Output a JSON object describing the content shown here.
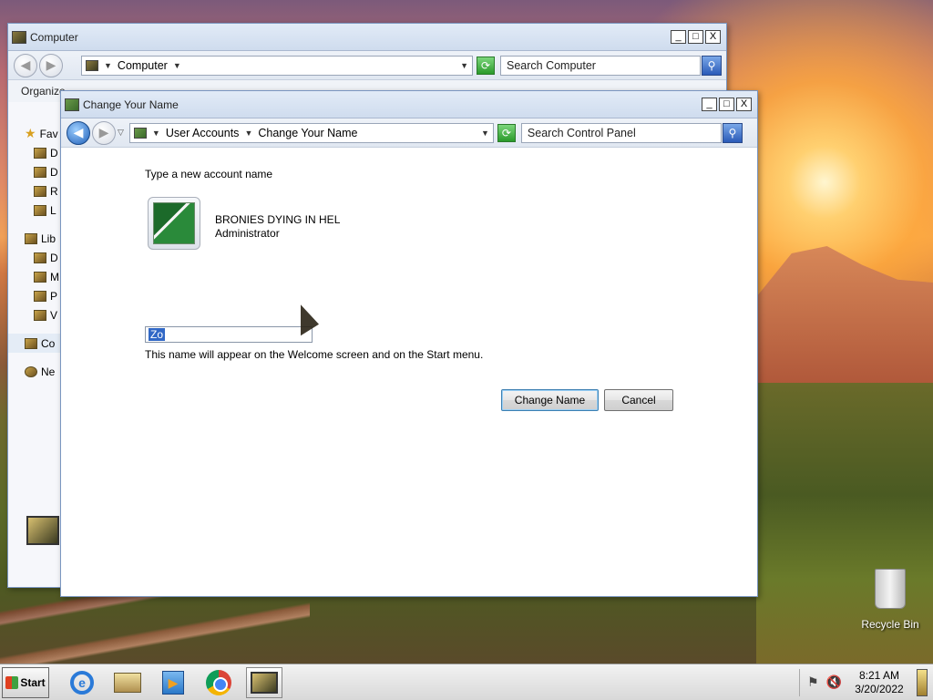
{
  "desktop": {
    "recycle_bin_label": "Recycle Bin"
  },
  "back_window": {
    "title": "Computer",
    "address": "Computer",
    "search_placeholder": "Search Computer",
    "toolbar_organize": "Organize",
    "nav_items": [
      "Favorites",
      "D",
      "D",
      "R",
      "L",
      "Libraries",
      "D",
      "M",
      "P",
      "V",
      "Computer",
      "Network"
    ],
    "nav_labels_visible": [
      "Fav",
      "D",
      "D",
      "R",
      "L",
      "Lib",
      "D",
      "M",
      "P",
      "V",
      "Co",
      "Ne"
    ]
  },
  "front_window": {
    "title": "Change Your Name",
    "breadcrumb": [
      "User Accounts",
      "Change Your Name"
    ],
    "search_placeholder": "Search Control Panel",
    "heading": "Type a new account name",
    "user_name": "BRONIES DYING IN HEL",
    "user_role": "Administrator",
    "name_input_value": "Zo",
    "hint": "This name will appear on the Welcome screen and on the Start menu.",
    "change_name_button": "Change Name",
    "cancel_button": "Cancel"
  },
  "window_controls": {
    "minimize": "_",
    "maximize": "□",
    "close": "X"
  },
  "taskbar": {
    "start_label": "Start",
    "time": "8:21 AM",
    "date": "3/20/2022",
    "icons": [
      "internet-explorer-icon",
      "file-explorer-icon",
      "media-player-icon",
      "chrome-icon",
      "computer-icon"
    ]
  }
}
